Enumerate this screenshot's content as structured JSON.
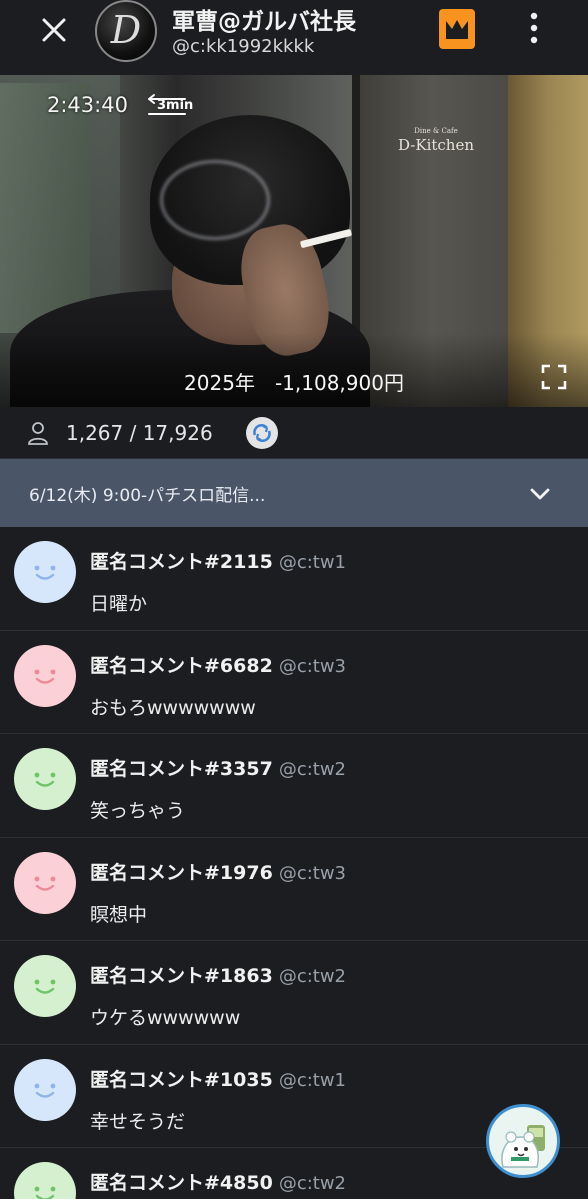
{
  "header": {
    "logo_letter": "D",
    "channel_name": "軍曹@ガルバ社長",
    "channel_id": "@c:kk1992kkkk"
  },
  "video": {
    "elapsed": "2:43:40",
    "extend_label": "3min",
    "sign_small": "Dine & Cafe",
    "sign_main": "D-Kitchen",
    "total_text": "2025年　-1,108,900円"
  },
  "stats": {
    "viewers": "1,267 / 17,926"
  },
  "schedule": {
    "text": "6/12(木)  9:00-パチスロ配信..."
  },
  "comments": [
    {
      "name": "匿名コメント#2115",
      "handle": "@c:tw1",
      "text": "日曜か",
      "avatar_bg": "#d6e6fb",
      "face_color": "#8fb4e8"
    },
    {
      "name": "匿名コメント#6682",
      "handle": "@c:tw3",
      "text": "おもろwwwwwww",
      "avatar_bg": "#fbd0d6",
      "face_color": "#ee8a98"
    },
    {
      "name": "匿名コメント#3357",
      "handle": "@c:tw2",
      "text": "笑っちゃう",
      "avatar_bg": "#d5f0cf",
      "face_color": "#6fc46a"
    },
    {
      "name": "匿名コメント#1976",
      "handle": "@c:tw3",
      "text": "瞑想中",
      "avatar_bg": "#fbd0d6",
      "face_color": "#ee8a98"
    },
    {
      "name": "匿名コメント#1863",
      "handle": "@c:tw2",
      "text": "ウケるwwwwww",
      "avatar_bg": "#d5f0cf",
      "face_color": "#6fc46a"
    },
    {
      "name": "匿名コメント#1035",
      "handle": "@c:tw1",
      "text": "幸せそうだ",
      "avatar_bg": "#d6e6fb",
      "face_color": "#8fb4e8"
    },
    {
      "name": "匿名コメント#4850",
      "handle": "@c:tw2",
      "text": "",
      "avatar_bg": "#d5f0cf",
      "face_color": "#6fc46a"
    }
  ],
  "colors": {
    "crown_badge": "#f7931e",
    "schedule_bar": "#4b5568",
    "background": "#1b1d21"
  }
}
